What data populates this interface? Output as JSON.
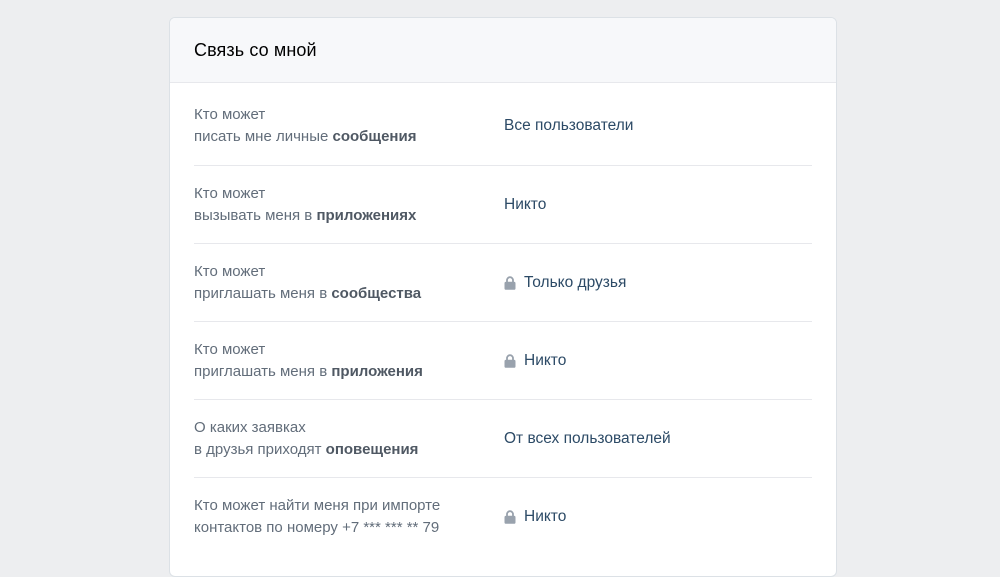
{
  "header": {
    "title": "Связь со мной"
  },
  "rows": [
    {
      "line1": "Кто может",
      "line2_pre": "писать мне личные ",
      "line2_bold": "сообщения",
      "value": "Все пользователи",
      "locked": false
    },
    {
      "line1": "Кто может",
      "line2_pre": "вызывать меня в ",
      "line2_bold": "приложениях",
      "value": "Никто",
      "locked": false
    },
    {
      "line1": "Кто может",
      "line2_pre": "приглашать меня в ",
      "line2_bold": "сообщества",
      "value": "Только друзья",
      "locked": true
    },
    {
      "line1": "Кто может",
      "line2_pre": "приглашать меня в ",
      "line2_bold": "приложения",
      "value": "Никто",
      "locked": true
    },
    {
      "line1": "О каких заявках",
      "line2_pre": "в друзья приходят ",
      "line2_bold": "оповещения",
      "value": "От всех пользователей",
      "locked": false
    },
    {
      "line1": "Кто может найти меня при импорте",
      "line2_pre": "контактов по номеру +7 *** *** ** 79",
      "line2_bold": "",
      "value": "Никто",
      "locked": true
    }
  ],
  "icons": {
    "lock": "lock-icon"
  },
  "colors": {
    "background": "#edeef0",
    "value_text": "#2c4a66",
    "label_text": "#626d7a",
    "lock_icon": "#99a2ad"
  }
}
